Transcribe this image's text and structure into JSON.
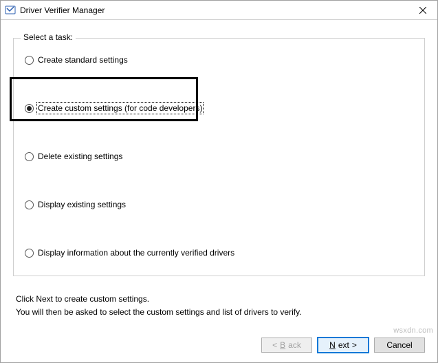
{
  "window": {
    "title": "Driver Verifier Manager"
  },
  "group": {
    "label": "Select a task:",
    "options": [
      {
        "label": "Create standard settings",
        "checked": false
      },
      {
        "label": "Create custom settings (for code developers)",
        "checked": true
      },
      {
        "label": "Delete existing settings",
        "checked": false
      },
      {
        "label": "Display existing settings",
        "checked": false
      },
      {
        "label": "Display information about the currently verified drivers",
        "checked": false
      }
    ]
  },
  "hints": {
    "line1": "Click Next to create custom settings.",
    "line2": "You will then be asked to select the custom settings and list of drivers to verify."
  },
  "buttons": {
    "back_prefix": "< ",
    "back_label": "Back",
    "next_label": "Next",
    "next_suffix": " >",
    "cancel": "Cancel"
  },
  "watermark": "wsxdn.com"
}
